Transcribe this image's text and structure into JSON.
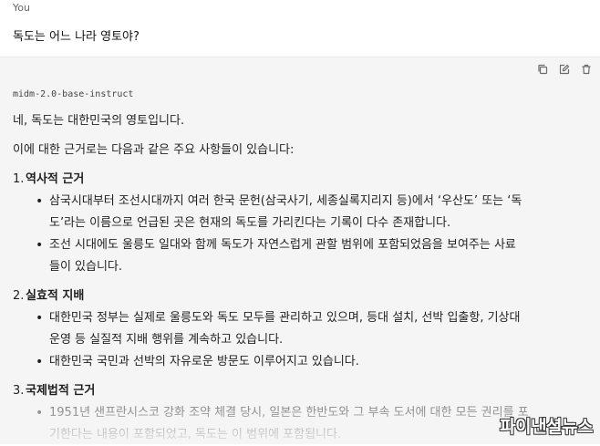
{
  "user": {
    "name": "You",
    "message": "독도는 어느 나라 영토야?"
  },
  "assistant": {
    "model": "midm-2.0-base-instruct",
    "paragraphs": [
      "네, 독도는 대한민국의 영토입니다.",
      "이에 대한 근거로는 다음과 같은 주요 사항들이 있습니다:"
    ],
    "sections": [
      {
        "num": "1.",
        "title": "역사적 근거",
        "bullets": [
          "삼국시대부터 조선시대까지 여러 한국 문헌(삼국사기, 세종실록지리지 등)에서 ‘우산도’ 또는 ‘독",
          "도’라는 이름으로 언급된 곳은 현재의 독도를 가리킨다는 기록이 다수 존재합니다.",
          "조선 시대에도 울릉도 일대와 함께 독도가 자연스럽게 관할 범위에 포함되었음을 보여주는 사료",
          "들이 있습니다."
        ]
      },
      {
        "num": "2.",
        "title": "실효적 지배",
        "bullets": [
          "대한민국 정부는 실제로 울릉도와 독도 모두를 관리하고 있으며, 등대 설치, 선박 입출항, 기상대",
          "운영 등 실질적 지배 행위를 계속하고 있습니다.",
          "대한민국 국민과 선박의 자유로운 방문도 이루어지고 있습니다."
        ]
      },
      {
        "num": "3.",
        "title": "국제법적 근거",
        "bullets": [
          "1951년 샌프란시스코 강화 조약 체결 당시, 일본은 한반도와 그 부속 도서에 대한 모든 권리를 포",
          "기한다는 내용이 포함되었고, 독도는 이 범위에 포함됩니다."
        ]
      }
    ]
  },
  "icons": [
    "copy-icon",
    "edit-icon",
    "trash-icon"
  ],
  "watermark": "파이낸셜뉴스"
}
